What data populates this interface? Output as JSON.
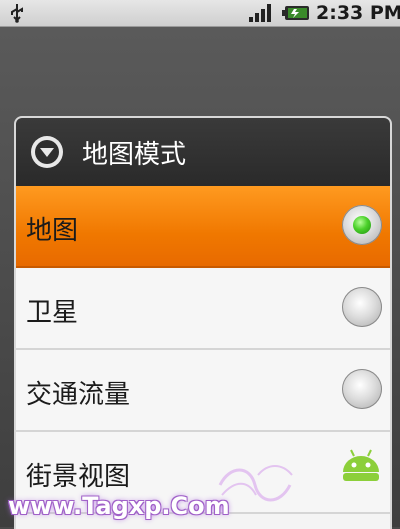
{
  "status_bar": {
    "time": "2:33 PM",
    "icons": [
      "usb-icon",
      "signal-icon",
      "battery-icon"
    ]
  },
  "dialog": {
    "title": "地图模式",
    "header_icon": "dropdown-circle-icon",
    "options": [
      {
        "label": "地图",
        "selected": true
      },
      {
        "label": "卫星",
        "selected": false
      },
      {
        "label": "交通流量",
        "selected": false
      },
      {
        "label": "街景视图",
        "selected": false
      }
    ]
  },
  "watermark": {
    "text": "www.Tagxp.Com"
  },
  "colors": {
    "selected_row": "#f07800",
    "header_bg": "#2e2e2e",
    "radio_on": "#4bd12a",
    "robot_icon": "#8ccf3a"
  }
}
